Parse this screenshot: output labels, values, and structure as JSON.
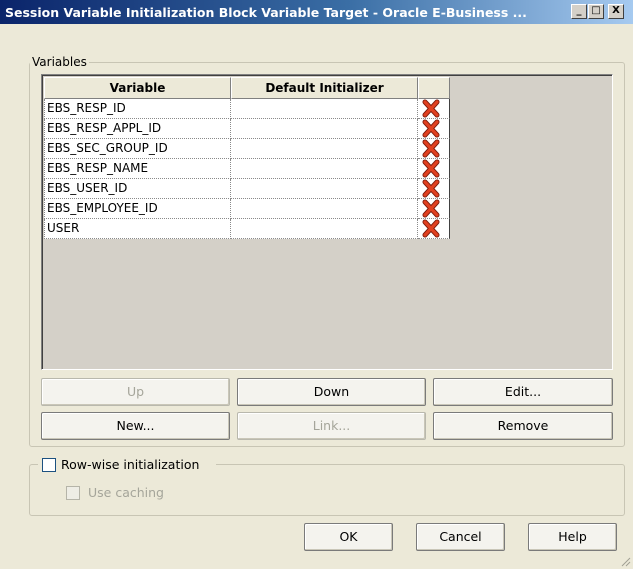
{
  "window": {
    "title": "Session Variable Initialization Block Variable Target - Oracle E-Business ...",
    "controls": {
      "minimize": "_",
      "maximize": "□",
      "close": "X"
    }
  },
  "variables_group": {
    "legend": "Variables",
    "columns": [
      "Variable",
      "Default Initializer",
      ""
    ],
    "rows": [
      {
        "variable": "EBS_RESP_ID",
        "default": "",
        "delete_icon": "red-x-delete-icon"
      },
      {
        "variable": "EBS_RESP_APPL_ID",
        "default": "",
        "delete_icon": "red-x-delete-icon"
      },
      {
        "variable": "EBS_SEC_GROUP_ID",
        "default": "",
        "delete_icon": "red-x-delete-icon"
      },
      {
        "variable": "EBS_RESP_NAME",
        "default": "",
        "delete_icon": "red-x-delete-icon"
      },
      {
        "variable": "EBS_USER_ID",
        "default": "",
        "delete_icon": "red-x-delete-icon"
      },
      {
        "variable": "EBS_EMPLOYEE_ID",
        "default": "",
        "delete_icon": "red-x-delete-icon"
      },
      {
        "variable": "USER",
        "default": "",
        "delete_icon": "red-x-delete-icon"
      }
    ],
    "buttons": {
      "up": "Up",
      "down": "Down",
      "edit": "Edit...",
      "new": "New...",
      "link": "Link...",
      "remove": "Remove"
    }
  },
  "rowwise_group": {
    "rowwise_label": "Row-wise initialization",
    "rowwise_checked": false,
    "caching_label": "Use caching",
    "caching_checked": false,
    "caching_enabled": false
  },
  "footer": {
    "ok": "OK",
    "cancel": "Cancel",
    "help": "Help"
  },
  "colors": {
    "title_bar_start": "#0a246a",
    "title_bar_end": "#a6caf0",
    "dialog_bg": "#ece9d8",
    "delete_icon": "#e04020"
  }
}
